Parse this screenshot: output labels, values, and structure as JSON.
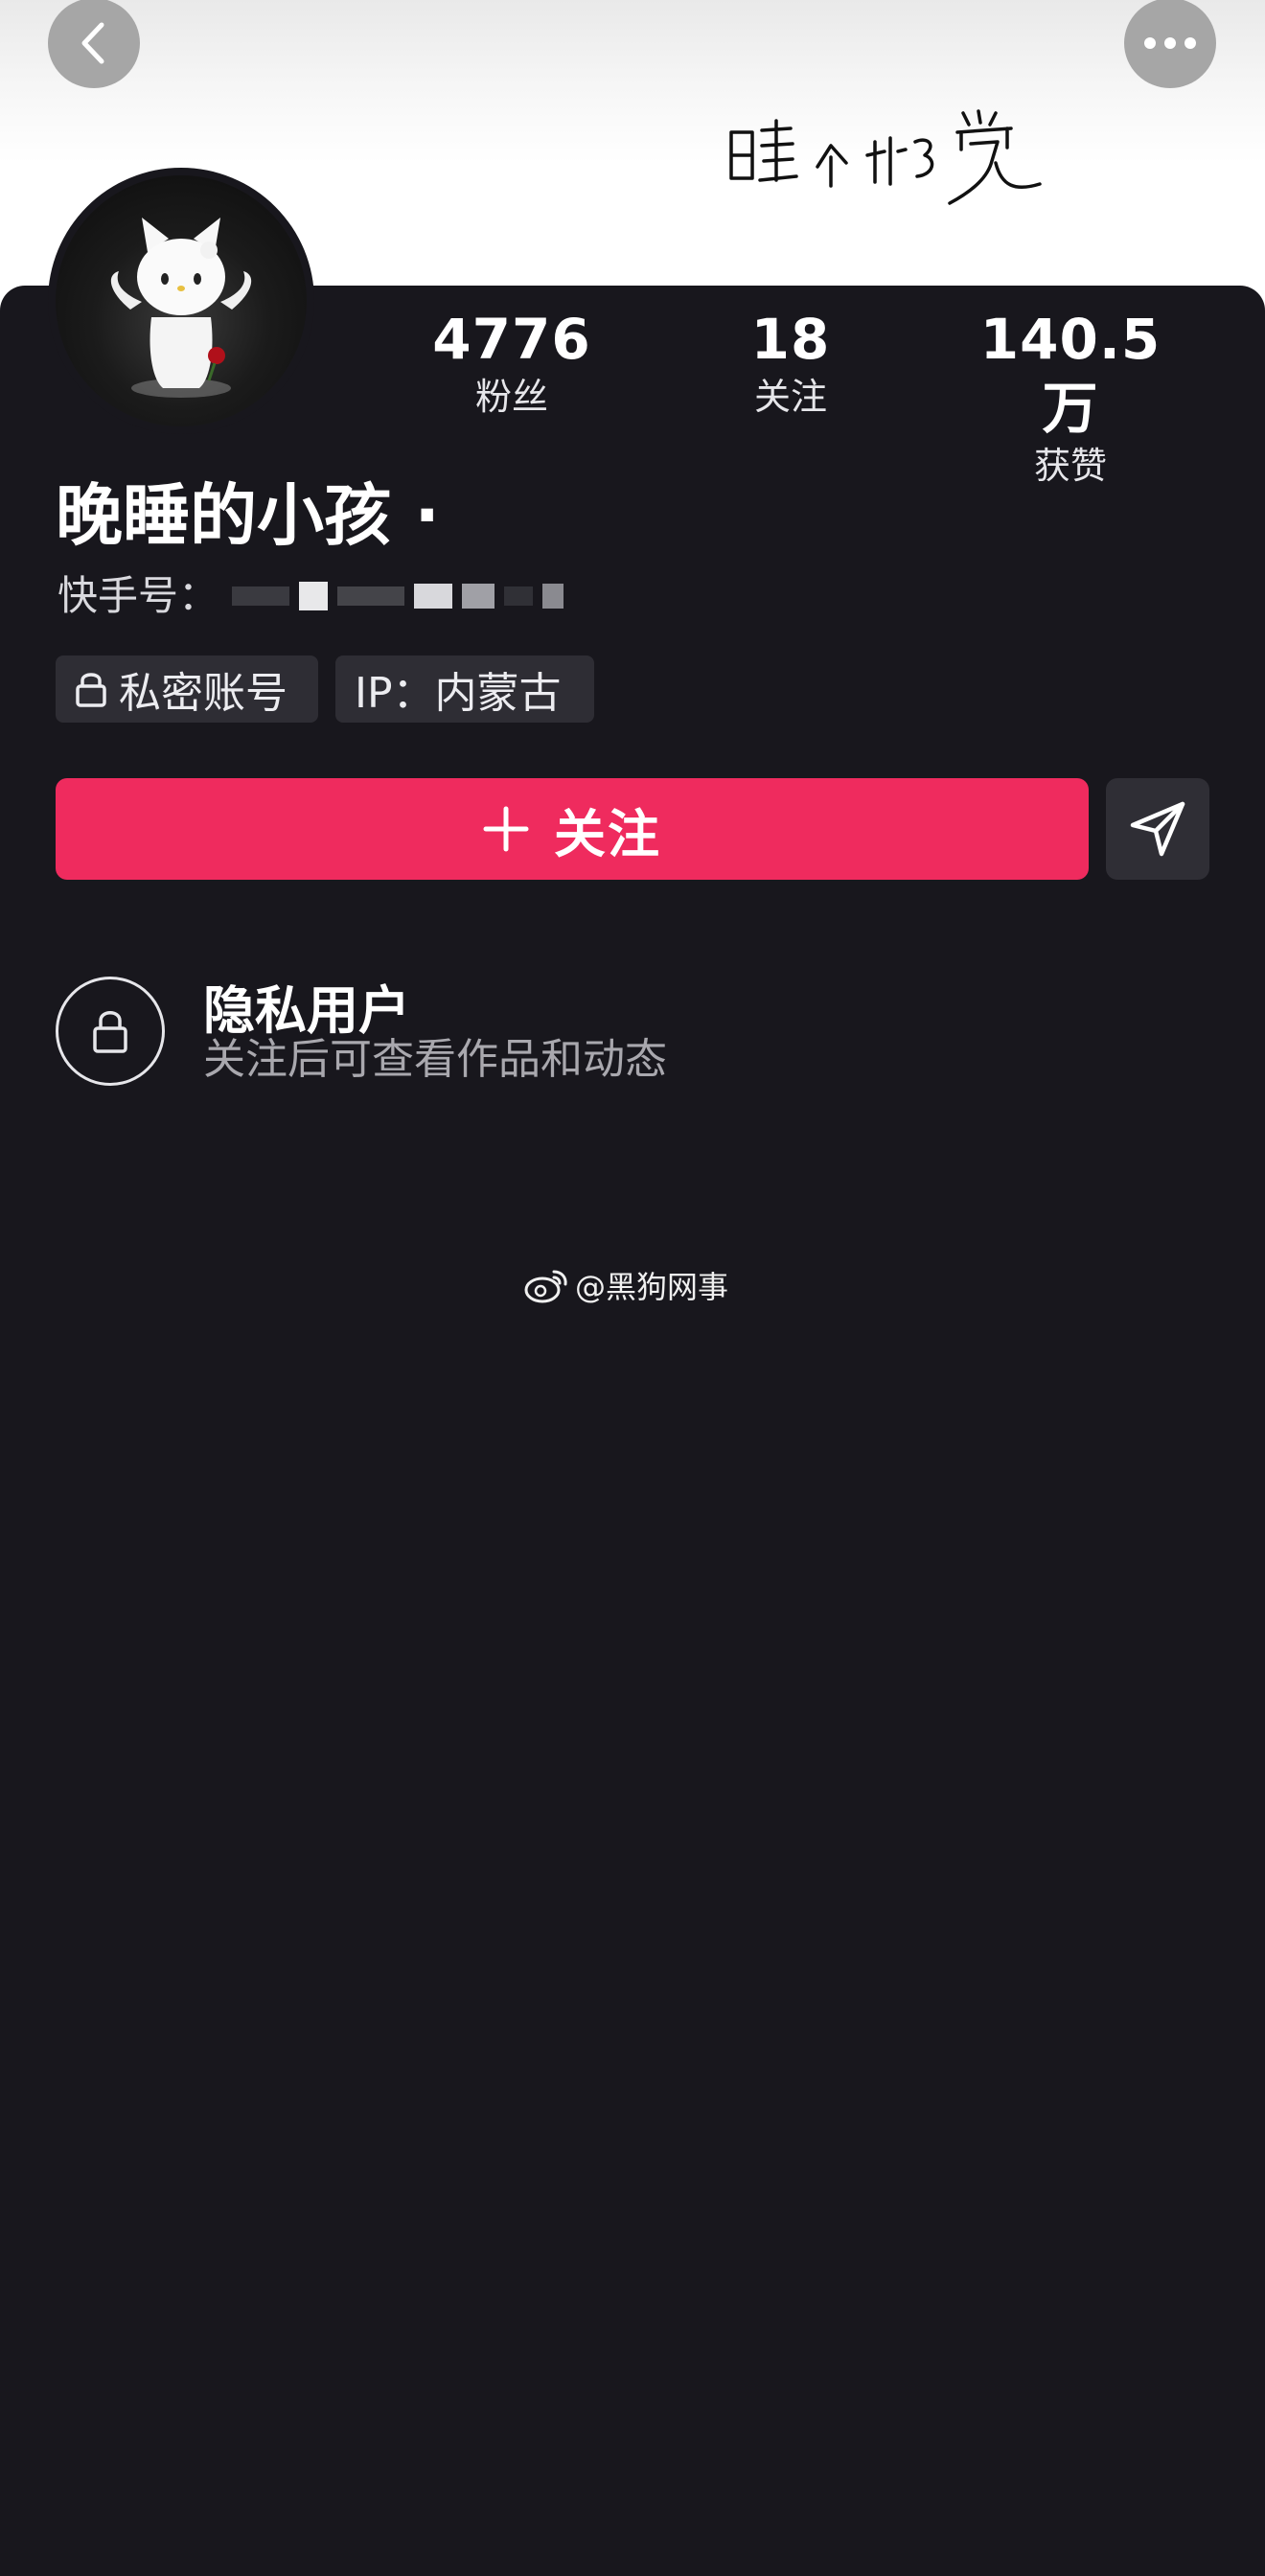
{
  "header": {
    "back_icon": "chevron-left-icon",
    "more_icon": "more-dots-icon",
    "banner_text": "睡个好觉"
  },
  "stats": [
    {
      "value": "4776",
      "label": "粉丝"
    },
    {
      "value": "18",
      "label": "关注"
    },
    {
      "value": "140.5万",
      "label": "获赞"
    }
  ],
  "profile": {
    "username": "晚睡的小孩 ·",
    "id_label": "快手号：",
    "tags": [
      {
        "icon": "lock-icon",
        "label": "私密账号"
      },
      {
        "label": "IP：内蒙古"
      }
    ]
  },
  "actions": {
    "follow_label": "关注",
    "follow_icon": "plus-icon",
    "share_icon": "send-icon",
    "follow_color": "#ef2b5e"
  },
  "privacy": {
    "title": "隐私用户",
    "description": "关注后可查看作品和动态"
  },
  "watermark": {
    "text": "@黑狗网事",
    "icon": "weibo-icon"
  },
  "colors": {
    "background": "#18171d",
    "accent": "#ef2b5e"
  }
}
